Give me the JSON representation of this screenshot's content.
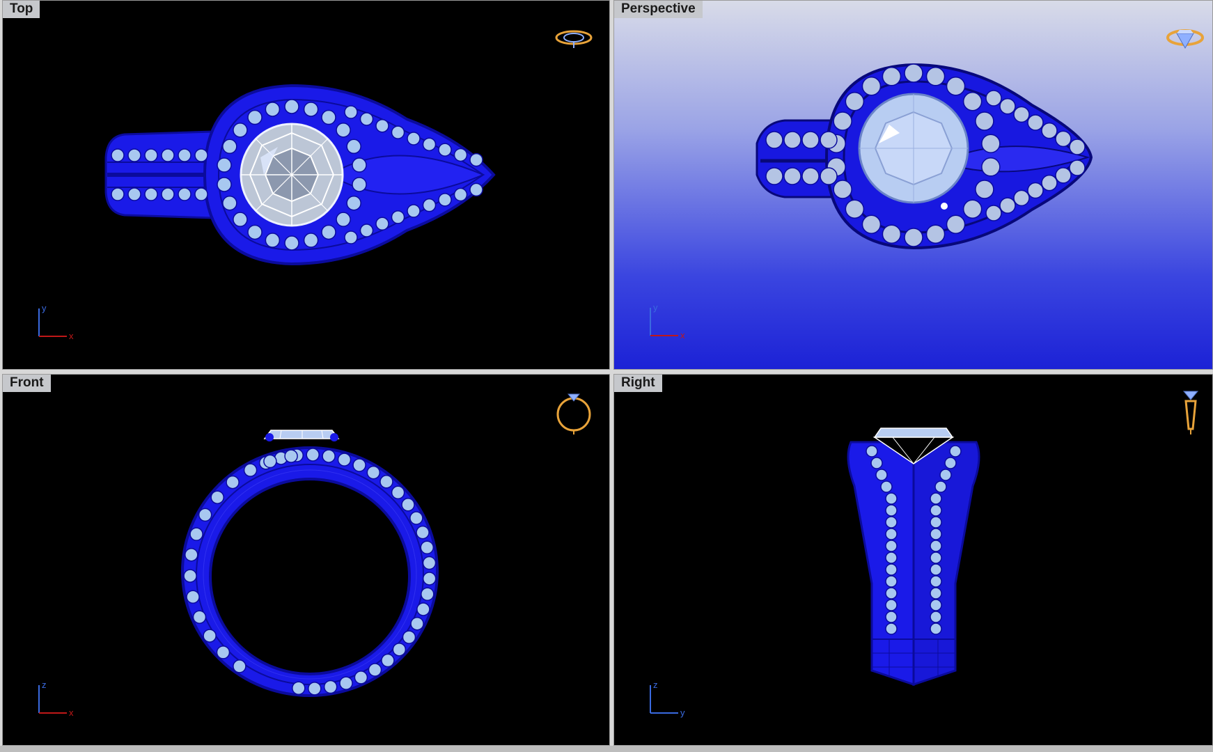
{
  "viewports": {
    "top": {
      "label": "Top",
      "axis_h": "x",
      "axis_v": "y"
    },
    "perspective": {
      "label": "Perspective",
      "axis_h": "x",
      "axis_v": "y"
    },
    "front": {
      "label": "Front",
      "axis_h": "x",
      "axis_v": "z"
    },
    "right": {
      "label": "Right",
      "axis_h": "y",
      "axis_v": "z"
    }
  },
  "colors": {
    "metal": "#1a1ae8",
    "metal_dark": "#0b0b9c",
    "stone": "#a8c8f0",
    "gizmo": "#e8a33a",
    "axis_x": "#c01818",
    "axis_y_z": "#3a6ae0",
    "label_bg": "#c6c8cc"
  },
  "icons": {
    "top": "ring-top-gizmo-icon",
    "perspective": "ring-perspective-gizmo-icon",
    "front": "ring-front-gizmo-icon",
    "right": "ring-right-gizmo-icon"
  }
}
